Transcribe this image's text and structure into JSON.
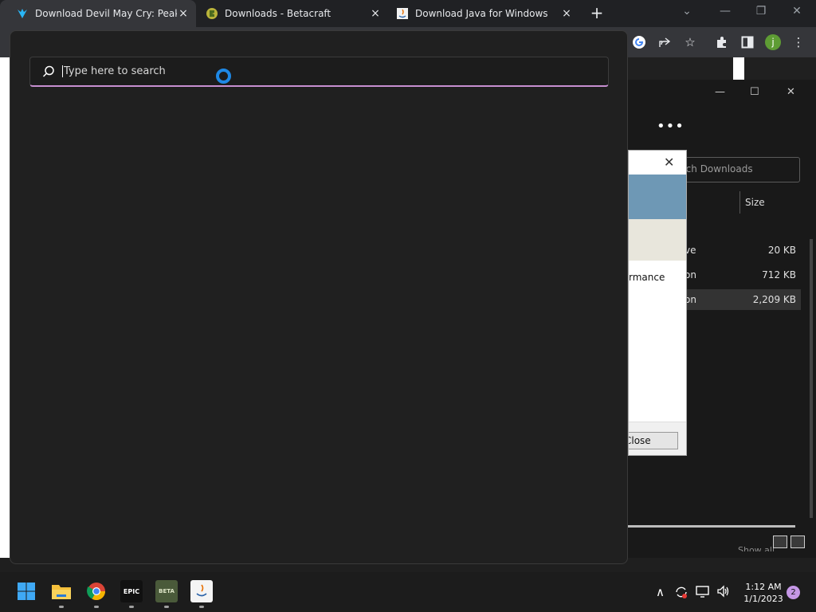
{
  "browser": {
    "tabs": [
      {
        "title": "Download Devil May Cry: Peak of",
        "icon": "dmc-favicon-icon"
      },
      {
        "title": "Downloads - Betacraft",
        "icon": "betacraft-favicon-icon"
      },
      {
        "title": "Download Java for Windows",
        "icon": "java-favicon-icon"
      }
    ],
    "new_tab_symbol": "+",
    "close_symbol": "×",
    "toolbar": {
      "profile_initial": "j",
      "more_symbol": "⋮"
    }
  },
  "search": {
    "placeholder": "Type here to search",
    "value": ""
  },
  "explorer": {
    "more_label": "•••",
    "search_placeholder": "rch Downloads",
    "column_header": "Size",
    "rows": [
      {
        "type": "ve",
        "size": "20 KB",
        "selected": false
      },
      {
        "type": "on",
        "size": "712 KB",
        "selected": false
      },
      {
        "type": "on",
        "size": "2,209 KB",
        "selected": true
      }
    ],
    "status_text": "Show all"
  },
  "dialog": {
    "close_symbol": "✕",
    "text": "rmance",
    "button_label": "Close"
  },
  "taskbar": {
    "apps": [
      "start-icon",
      "file-explorer-icon",
      "chrome-icon",
      "epic-games-icon",
      "betacraft-icon",
      "java-installer-icon"
    ],
    "epic_label": "EPIC",
    "betacraft_label": "BETA",
    "clock_time": "1:12 AM",
    "clock_date": "1/1/2023",
    "notification_count": "2",
    "tray_chevron": "∧"
  },
  "colors": {
    "search_accent": "#c78fd1",
    "cortana_blue": "#1e88e5",
    "notification_badge": "#c597e6"
  }
}
